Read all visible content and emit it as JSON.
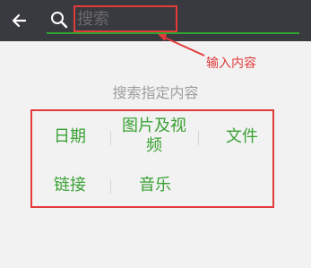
{
  "search": {
    "input_value": "搜索"
  },
  "callout": {
    "text": "输入内容"
  },
  "section": {
    "title": "搜索指定内容"
  },
  "categories": [
    {
      "label": "日期"
    },
    {
      "label": "图片及视频"
    },
    {
      "label": "文件"
    },
    {
      "label": "链接"
    },
    {
      "label": "音乐"
    }
  ],
  "icons": {
    "back": "back-arrow-icon",
    "search": "search-icon"
  },
  "colors": {
    "topbar": "#393a3f",
    "accent_green": "#3aa135",
    "annotation_red": "#e23b3b",
    "muted_text": "#9e9e9e"
  }
}
